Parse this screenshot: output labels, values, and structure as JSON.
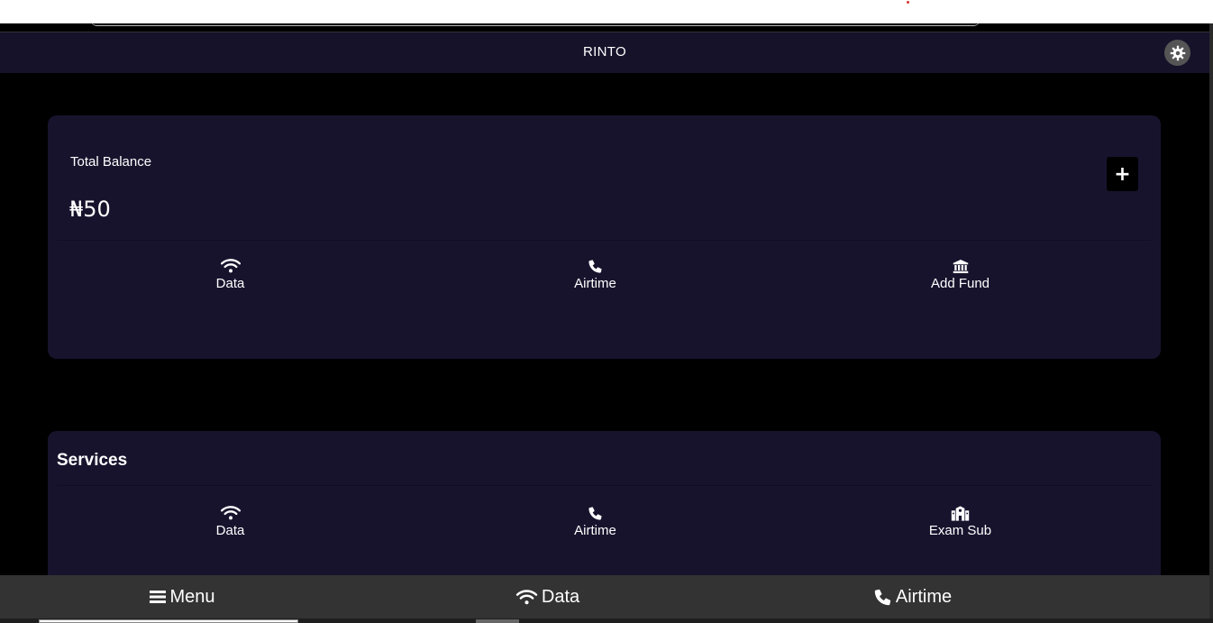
{
  "app": {
    "title": "RINTO"
  },
  "balance": {
    "label": "Total Balance",
    "amount": "₦50",
    "add_button_label": "+"
  },
  "quick_actions": [
    {
      "label": "Data",
      "icon": "wifi-icon"
    },
    {
      "label": "Airtime",
      "icon": "phone-icon"
    },
    {
      "label": "Add Fund",
      "icon": "bank-icon"
    }
  ],
  "services": {
    "title": "Services",
    "items": [
      {
        "label": "Data",
        "icon": "wifi-icon"
      },
      {
        "label": "Airtime",
        "icon": "phone-icon"
      },
      {
        "label": "Exam Sub",
        "icon": "school-icon"
      }
    ]
  },
  "bottom_nav": [
    {
      "label": "Menu",
      "icon": "menu-icon"
    },
    {
      "label": "Data",
      "icon": "wifi-icon"
    },
    {
      "label": "Airtime",
      "icon": "phone-icon"
    }
  ],
  "colors": {
    "topbar": "#16122a",
    "card": "#18132d",
    "background": "#000000",
    "bottom_nav": "#333333"
  }
}
